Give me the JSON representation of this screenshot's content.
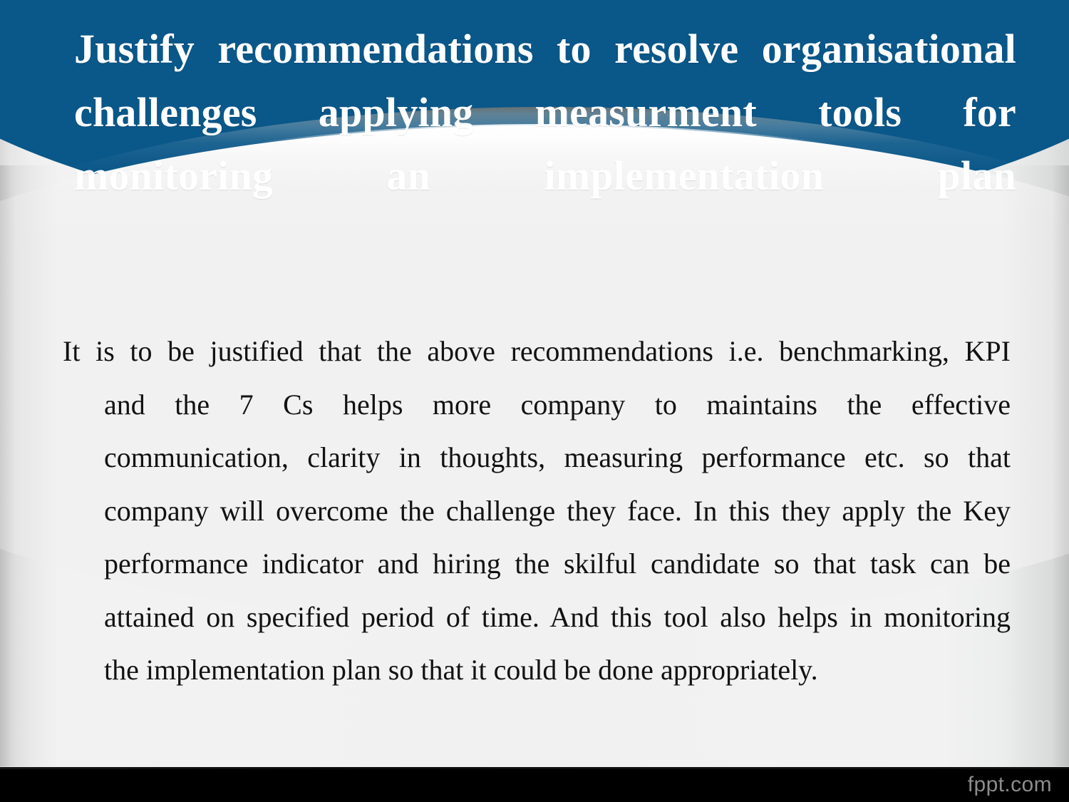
{
  "slide": {
    "title_lines": [
      "Justify   recommendations   to   resolve",
      "organisational        challenges        applying",
      "measurment     tools     for     monitoring     an",
      "implementation plan"
    ],
    "title_full": "Justify recommendations to resolve organisational challenges applying measurment tools for monitoring an implementation plan",
    "body_lines": [
      "It is to be justified that the above recommendations i.e. benchmarking, KPI",
      "and   the   7   Cs   helps   more   company   to   maintains   the   effective",
      "communication,  clarity  in  thoughts,  measuring  performance  etc.  so  that",
      "company will overcome the challenge they face. In this they apply the Key",
      "performance  indicator  and  hiring  the  skilful  candidate  so  that  task  can  be",
      "attained on specified period of time. And this tool also helps in monitoring",
      "the implementation plan so that it could be done appropriately."
    ],
    "body_full": "It is to be justified that the above recommendations i.e. benchmarking, KPI and the 7 Cs helps more company to maintains the effective communication, clarity in thoughts, measuring performance etc. so that company will overcome the challenge they face. In this they apply the Key performance indicator and hiring the skilful candidate so that task can be attained on specified period of time. And this tool also helps in monitoring the implementation plan so that it could be done appropriately.",
    "watermark": "fppt.com",
    "colors": {
      "header_blue": "#0a5789",
      "title_text": "#ffffff",
      "body_text": "#121212",
      "background": "#f1f1f1",
      "footer_bar": "#000000",
      "watermark_text": "#8c8c8c"
    }
  }
}
